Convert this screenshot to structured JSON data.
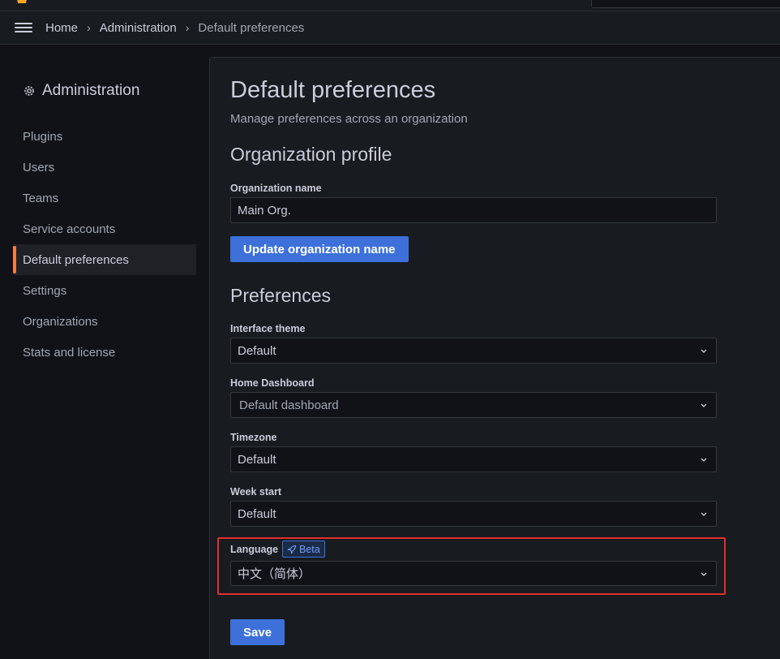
{
  "breadcrumb": {
    "items": [
      "Home",
      "Administration",
      "Default preferences"
    ],
    "separator": "›"
  },
  "sidebar": {
    "title": "Administration",
    "items": [
      {
        "label": "Plugins",
        "active": false
      },
      {
        "label": "Users",
        "active": false
      },
      {
        "label": "Teams",
        "active": false
      },
      {
        "label": "Service accounts",
        "active": false
      },
      {
        "label": "Default preferences",
        "active": true
      },
      {
        "label": "Settings",
        "active": false
      },
      {
        "label": "Organizations",
        "active": false
      },
      {
        "label": "Stats and license",
        "active": false
      }
    ]
  },
  "main": {
    "title": "Default preferences",
    "subtitle": "Manage preferences across an organization",
    "org_profile": {
      "heading": "Organization profile",
      "name_label": "Organization name",
      "name_value": "Main Org.",
      "update_button": "Update organization name"
    },
    "preferences": {
      "heading": "Preferences",
      "theme": {
        "label": "Interface theme",
        "value": "Default"
      },
      "home_dashboard": {
        "label": "Home Dashboard",
        "placeholder": "Default dashboard"
      },
      "timezone": {
        "label": "Timezone",
        "value": "Default"
      },
      "week_start": {
        "label": "Week start",
        "value": "Default"
      },
      "language": {
        "label": "Language",
        "badge": "Beta",
        "value": "中文（简体）"
      },
      "save_button": "Save"
    }
  },
  "colors": {
    "accent_primary": "#3d71d9",
    "active_indicator": "#ff7a3d",
    "highlight_box": "#e02f2f",
    "background": "#111217",
    "panel": "#181b1f"
  },
  "icons": [
    "grafana-logo-icon",
    "menu-icon",
    "cog-icon",
    "rocket-icon",
    "chevron-down-icon"
  ]
}
